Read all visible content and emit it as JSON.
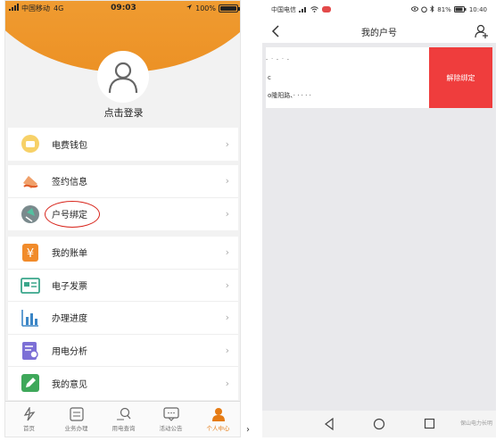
{
  "left": {
    "status": {
      "carrier": "中国移动",
      "network": "4G",
      "time": "09:03",
      "battery": "100%"
    },
    "login_text": "点击登录",
    "groups": [
      [
        {
          "label": "电费钱包",
          "icon": "wallet-icon"
        }
      ],
      [
        {
          "label": "签约信息",
          "icon": "sign-icon"
        },
        {
          "label": "户号绑定",
          "icon": "bind-icon"
        }
      ],
      [
        {
          "label": "我的账单",
          "icon": "bill-icon"
        },
        {
          "label": "电子发票",
          "icon": "invoice-icon"
        },
        {
          "label": "办理进度",
          "icon": "progress-icon"
        },
        {
          "label": "用电分析",
          "icon": "analysis-icon"
        },
        {
          "label": "我的意见",
          "icon": "feedback-icon"
        }
      ]
    ],
    "chevron": "›",
    "tabs": [
      {
        "label": "首页",
        "icon": "home-icon"
      },
      {
        "label": "业务办理",
        "icon": "business-icon"
      },
      {
        "label": "用电查询",
        "icon": "query-icon"
      },
      {
        "label": "活动公告",
        "icon": "notice-icon"
      },
      {
        "label": "个人中心",
        "icon": "person-icon",
        "active": true
      }
    ],
    "colors": {
      "accent": "#ec9125",
      "highlight_circle": "#d8261d"
    }
  },
  "right": {
    "status": {
      "carrier": "中国电信",
      "battery": "81%",
      "time": "10:40"
    },
    "title": "我的户号",
    "account": {
      "line1": "- · - · -",
      "line2": "c",
      "line3": "o隆阳路、· · · · ·"
    },
    "unbind_label": "解除绑定",
    "watermark": "保山电力长明",
    "colors": {
      "unbind": "#ef3d3d"
    }
  },
  "tick_mark": "›"
}
